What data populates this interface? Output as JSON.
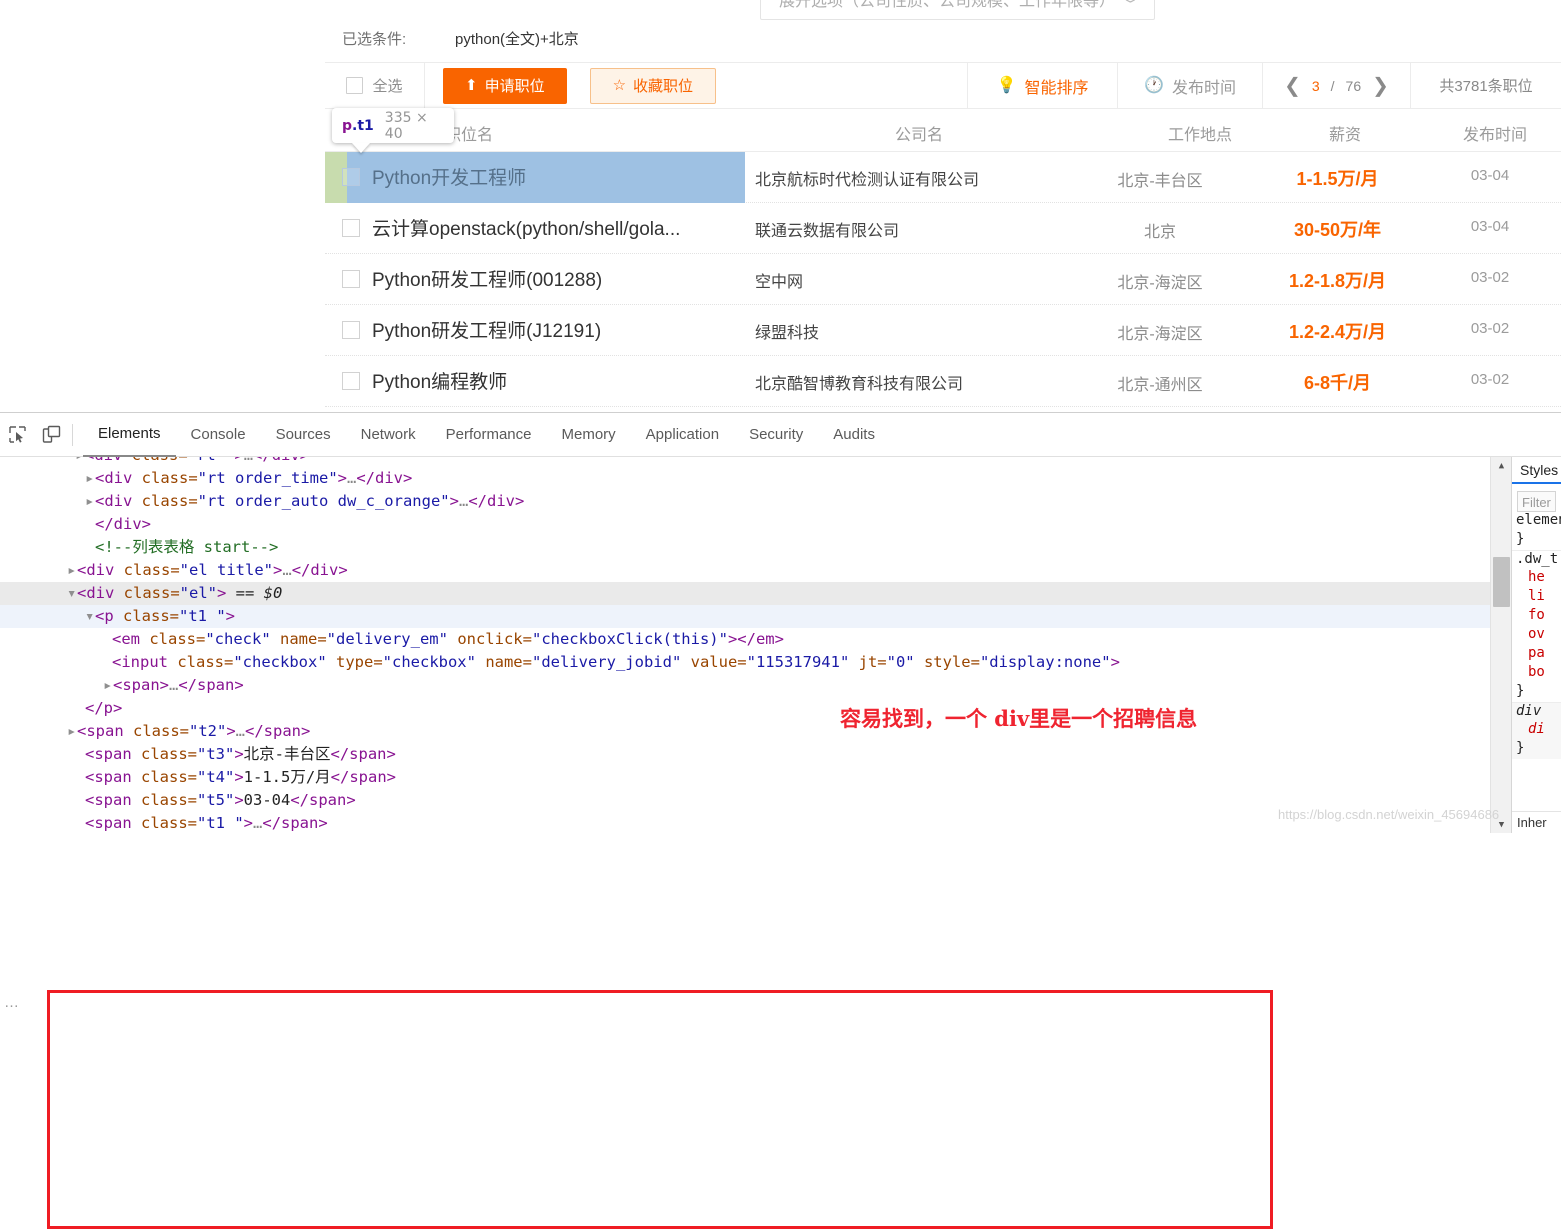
{
  "page": {
    "expand_filter": {
      "label": "展开选项（公司性质、公司规模、工作年限等）",
      "chevron": "chevron-down-icon"
    },
    "condition": {
      "label": "已选条件:",
      "value": "python(全文)+北京"
    },
    "toolbar": {
      "select_all": "全选",
      "apply_button": "申请职位",
      "favorite_button": "收藏职位",
      "smart_sort": "智能排序",
      "post_time": "发布时间",
      "pager": {
        "prev": "❮",
        "current": "3",
        "separator": "/",
        "total_pages": "76",
        "next": "❯"
      },
      "total_jobs": "共3781条职位"
    },
    "columns": [
      "职位名",
      "公司名",
      "工作地点",
      "薪资",
      "发布时间"
    ],
    "rows": [
      {
        "title": "Python开发工程师",
        "company": "北京航标时代检测认证有限公司",
        "location": "北京-丰台区",
        "salary": "1-1.5万/月",
        "date": "03-04"
      },
      {
        "title": "云计算openstack(python/shell/gola...",
        "company": "联通云数据有限公司",
        "location": "北京",
        "salary": "30-50万/年",
        "date": "03-04"
      },
      {
        "title": "Python研发工程师(001288)",
        "company": "空中网",
        "location": "北京-海淀区",
        "salary": "1.2-1.8万/月",
        "date": "03-02"
      },
      {
        "title": "Python研发工程师(J12191)",
        "company": "绿盟科技",
        "location": "北京-海淀区",
        "salary": "1.2-2.4万/月",
        "date": "03-02"
      },
      {
        "title": "Python编程教师",
        "company": "北京酷智博教育科技有限公司",
        "location": "北京-通州区",
        "salary": "6-8千/月",
        "date": "03-02"
      }
    ],
    "tooltip": {
      "tag": "p",
      "cls": ".t1",
      "dimensions": "335 × 40"
    },
    "colors": {
      "accent": "#f96400",
      "highlight_content": "#9ec1e3",
      "highlight_margin": "#c8dcae"
    }
  },
  "devtools": {
    "tabs": [
      "Elements",
      "Console",
      "Sources",
      "Network",
      "Performance",
      "Memory",
      "Application",
      "Security",
      "Audits"
    ],
    "active_tab": "Elements",
    "icons": [
      "inspect-element-icon",
      "device-toolbar-icon"
    ],
    "dom_lines": [
      "<div class=\"rt\">…</div>",
      "<div class=\"rt order_time\">…</div>",
      "<div class=\"rt order_auto dw_c_orange\">…</div>",
      "</div>",
      "<!--列表表格 start-->",
      "<div class=\"el title\">…</div>",
      "<div class=\"el\"> == $0",
      "<p class=\"t1 \">",
      "<em class=\"check\" name=\"delivery_em\" onclick=\"checkboxClick(this)\"></em>",
      "<input class=\"checkbox\" type=\"checkbox\" name=\"delivery_jobid\" value=\"115317941\" jt=\"0\" style=\"display:none\">",
      "<span>…</span>",
      "</p>",
      "<span class=\"t2\">…</span>",
      "<span class=\"t3\">北京-丰台区</span>",
      "<span class=\"t4\">1-1.5万/月</span>",
      "<span class=\"t5\">03-04</span>"
    ],
    "selected_marker": "== $0",
    "comment_text": "列表表格 start",
    "dom_values": {
      "checkbox_value": "115317941",
      "jt": "0",
      "style": "display:none",
      "t3_text": "北京-丰台区",
      "t4_text": "1-1.5万/月",
      "t5_text": "03-04"
    },
    "annotation": "容易找到，一个 div里是一个招聘信息",
    "styles_pane": {
      "tab": "Styles",
      "filter_placeholder": "Filter",
      "lines": [
        "element",
        "}",
        ".dw_t",
        "he",
        "li",
        "fo",
        "ov",
        "pa",
        "bo",
        "}",
        "div",
        "di",
        "}"
      ],
      "inherit_label": "Inher"
    },
    "ellipsis_menu": "…"
  },
  "watermark": "https://blog.csdn.net/weixin_45694686"
}
